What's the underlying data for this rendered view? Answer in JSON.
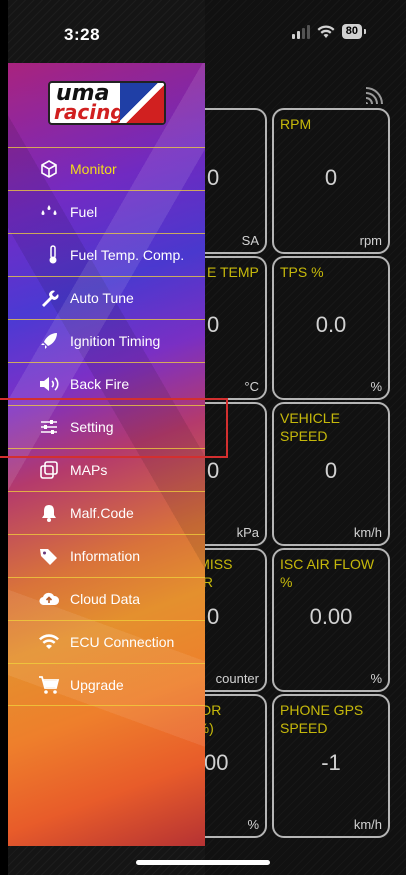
{
  "status_bar": {
    "time": "3:28",
    "battery": "80"
  },
  "drawer": {
    "logo": {
      "line1": "uma",
      "line2": "racing"
    },
    "items": [
      {
        "label": "Monitor",
        "icon": "cube-icon",
        "active": true
      },
      {
        "label": "Fuel",
        "icon": "fuel-drops-icon"
      },
      {
        "label": "Fuel Temp. Comp.",
        "icon": "thermometer-icon"
      },
      {
        "label": "Auto Tune",
        "icon": "wrench-icon"
      },
      {
        "label": "Ignition Timing",
        "icon": "rocket-icon"
      },
      {
        "label": "Back Fire",
        "icon": "speaker-icon"
      },
      {
        "label": "Setting",
        "icon": "sliders-icon"
      },
      {
        "label": "MAPs",
        "icon": "map-copy-icon"
      },
      {
        "label": "Malf.Code",
        "icon": "bell-icon"
      },
      {
        "label": "Information",
        "icon": "tag-icon"
      },
      {
        "label": "Cloud Data",
        "icon": "cloud-upload-icon"
      },
      {
        "label": "ECU Connection",
        "icon": "wifi-icon"
      },
      {
        "label": "Upgrade",
        "icon": "cart-icon"
      }
    ]
  },
  "tiles": {
    "left": [
      {
        "title": "",
        "value": "0",
        "unit": "SA"
      },
      {
        "title": "E TEMP",
        "value": "0",
        "unit": "°C"
      },
      {
        "title": "",
        "value": "0",
        "unit": "kPa"
      },
      {
        "title": "K MISS\nTER",
        "value": "0",
        "unit": "counter"
      },
      {
        "title": "TOR\n(%)",
        "value": "00",
        "unit": "%"
      }
    ],
    "right": [
      {
        "title": "RPM",
        "value": "0",
        "unit": "rpm"
      },
      {
        "title": "TPS %",
        "value": "0.0",
        "unit": "%"
      },
      {
        "title": "VEHICLE\nSPEED",
        "value": "0",
        "unit": "km/h"
      },
      {
        "title": "ISC AIR FLOW\n%",
        "value": "0.00",
        "unit": "%"
      },
      {
        "title": "PHONE GPS\nSPEED",
        "value": "-1",
        "unit": "km/h"
      }
    ]
  },
  "colors": {
    "accent": "#f3dd1a",
    "highlight": "#d32f2f",
    "background": "#151515"
  }
}
